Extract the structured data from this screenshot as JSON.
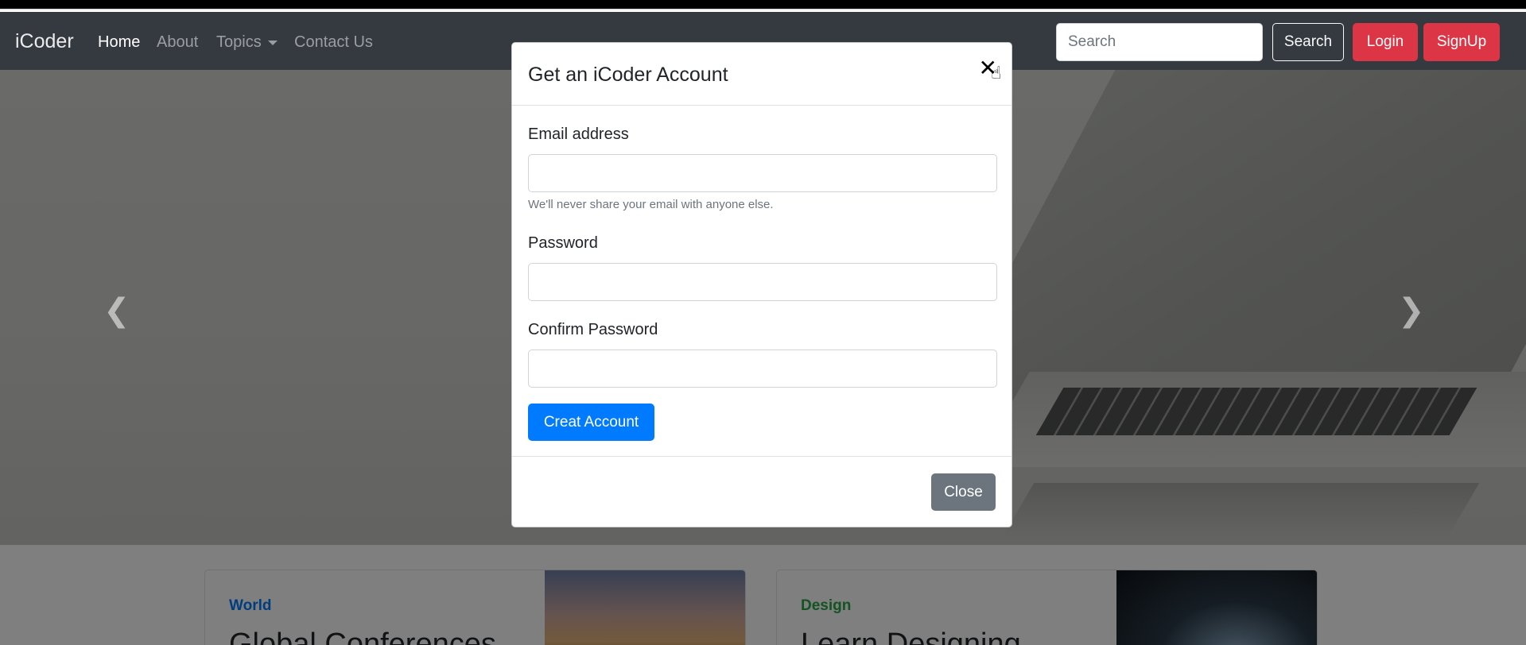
{
  "navbar": {
    "brand": "iCoder",
    "links": [
      {
        "label": "Home"
      },
      {
        "label": "About"
      },
      {
        "label": "Topics"
      },
      {
        "label": "Contact Us"
      }
    ],
    "search_placeholder": "Search",
    "search_button": "Search",
    "login_button": "Login",
    "signup_button": "SignUp"
  },
  "carousel": {
    "prev_icon": "chevron-left-icon",
    "next_icon": "chevron-right-icon",
    "prev_glyph": "❮",
    "next_glyph": "❯"
  },
  "cards": [
    {
      "tag": "World",
      "title": "Global Conferences",
      "tag_color": "#007bff"
    },
    {
      "tag": "Design",
      "title": "Learn Designing",
      "tag_color": "#28a745"
    }
  ],
  "modal": {
    "title": "Get an iCoder Account",
    "close_glyph": "✕",
    "email_label": "Email address",
    "email_help": "We'll never share your email with anyone else.",
    "email_value": "",
    "password_label": "Password",
    "password_value": "",
    "confirm_label": "Confirm Password",
    "confirm_value": "",
    "submit_button": "Creat Account",
    "close_button": "Close"
  },
  "colors": {
    "navbar_bg": "#343a40",
    "primary": "#007bff",
    "danger": "#dc3545",
    "secondary": "#6c757d"
  }
}
